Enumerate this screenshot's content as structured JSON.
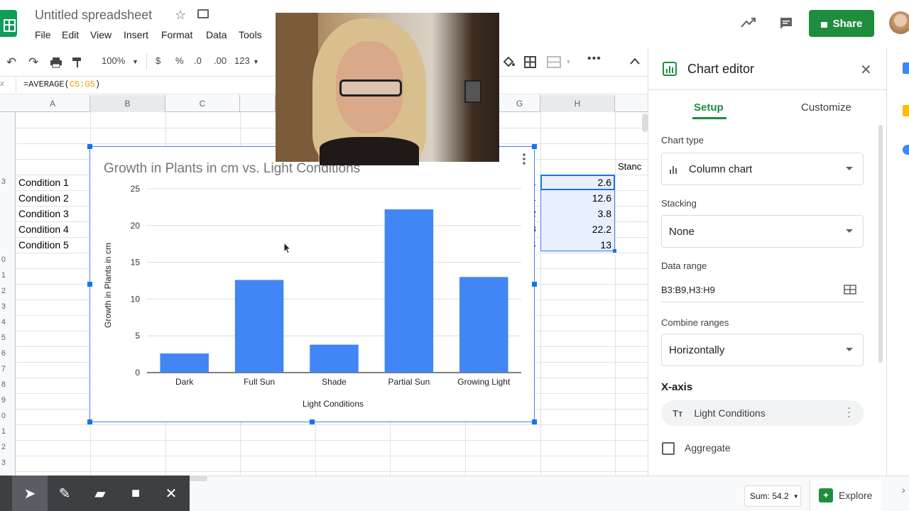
{
  "header": {
    "doc_title": "Untitled spreadsheet",
    "menus": [
      "File",
      "Edit",
      "View",
      "Insert",
      "Format",
      "Data",
      "Tools"
    ],
    "share_label": "Share"
  },
  "toolbar": {
    "zoom": "100%",
    "currency": "$",
    "percent": "%",
    "dec_dec": ".0",
    "inc_dec": ".00",
    "more_formats": "123"
  },
  "formula_bar": {
    "prefix": "=AVERAGE(",
    "range": "C5:G5",
    "suffix": ")"
  },
  "columns": [
    "A",
    "B",
    "C",
    "G",
    "H"
  ],
  "rows_visible": [
    "",
    "",
    "",
    "3",
    "",
    "",
    "",
    "",
    "",
    "0",
    "1",
    "2",
    "3",
    "4",
    "5",
    "6",
    "7",
    "8",
    "9",
    "0",
    "1",
    "2",
    "3"
  ],
  "cells": {
    "conditions": [
      "Condition 1",
      "Condition 2",
      "Condition 3",
      "Condition 4",
      "Condition 5"
    ],
    "h_values": [
      "2.6",
      "12.6",
      "3.8",
      "22.2",
      "13"
    ],
    "g_partial": [
      "1",
      "1",
      "2",
      "3",
      "4"
    ],
    "standard_partial": "Stanc"
  },
  "chart_data": {
    "type": "bar",
    "title": "Growth in Plants in cm vs. Light Conditions",
    "xlabel": "Light Conditions",
    "ylabel": "Growth in Plants in cm",
    "categories": [
      "Dark",
      "Full Sun",
      "Shade",
      "Partial Sun",
      "Growing Light"
    ],
    "values": [
      2.6,
      12.6,
      3.8,
      22.2,
      13
    ],
    "ylim": [
      0,
      25
    ],
    "yticks": [
      "0",
      "5",
      "10",
      "15",
      "20",
      "25"
    ],
    "bar_color": "#4285f4",
    "grid": true
  },
  "editor": {
    "title": "Chart editor",
    "tabs": [
      "Setup",
      "Customize"
    ],
    "chart_type_label": "Chart type",
    "chart_type_value": "Column chart",
    "stacking_label": "Stacking",
    "stacking_value": "None",
    "data_range_label": "Data range",
    "data_range_value": "B3:B9,H3:H9",
    "combine_label": "Combine ranges",
    "combine_value": "Horizontally",
    "xaxis_heading": "X-axis",
    "xaxis_value": "Light Conditions",
    "aggregate_label": "Aggregate"
  },
  "bottom": {
    "sum": "Sum: 54.2",
    "explore": "Explore"
  },
  "colors": {
    "accent_green": "#1e8e3e",
    "selection_blue": "#1a73e8"
  }
}
